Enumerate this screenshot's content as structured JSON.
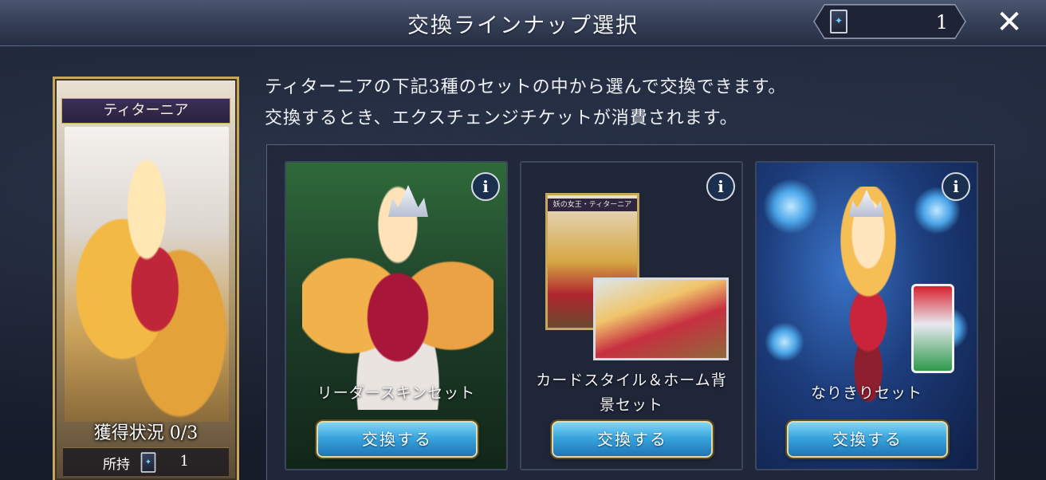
{
  "header": {
    "title": "交換ラインナップ選択",
    "ticket_count": "1",
    "close_label": "✕"
  },
  "character": {
    "name": "ティターニア",
    "acquisition_status": "獲得状況 0/3",
    "owned_label": "所持",
    "owned_count": "1"
  },
  "description": {
    "line1": "ティターニアの下記3種のセットの中から選んで交換できます。",
    "line2": "交換するとき、エクスチェンジチケットが消費されます。"
  },
  "cards": [
    {
      "label": "リーダースキンセット",
      "button_label": "交換する",
      "info_label": "i"
    },
    {
      "label": "カードスタイル＆ホーム背景セット",
      "button_label": "交換する",
      "info_label": "i",
      "thumb_label": "妖の女王・ティターニア"
    },
    {
      "label": "なりきりセット",
      "button_label": "交換する",
      "info_label": "i"
    }
  ],
  "colors": {
    "button_accent": "#39a5dc",
    "frame_gold": "#c9a75a",
    "panel_bg": "#21283a"
  },
  "icons": {
    "ticket": "ticket-icon",
    "info": "info-icon",
    "close": "close-icon"
  }
}
